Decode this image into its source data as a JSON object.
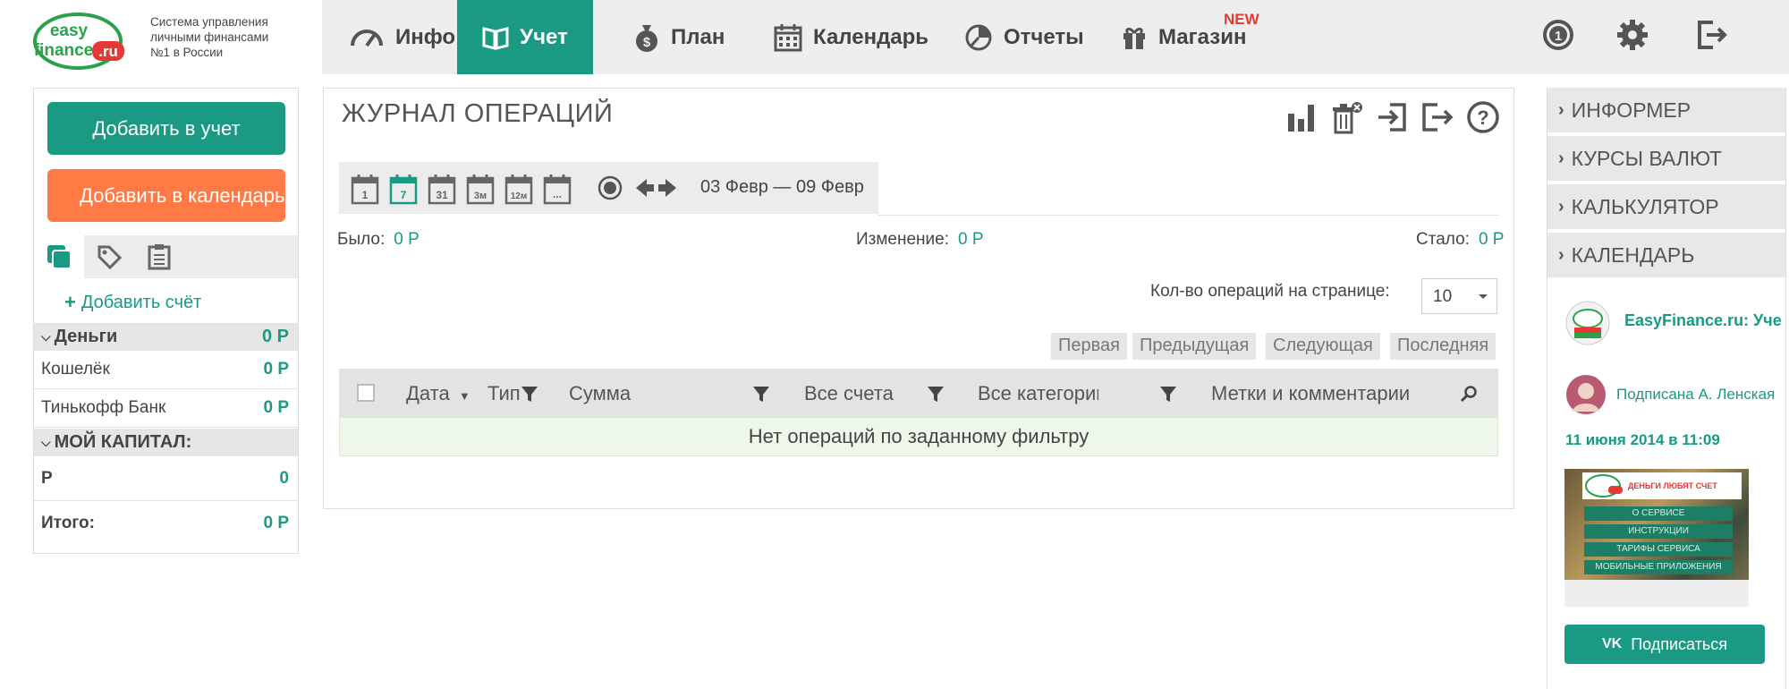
{
  "brand": {
    "logo_top": "easy",
    "logo_bottom": "finance",
    "logo_suffix": ".ru",
    "slogan": "Система управления личными финансами №1 в России"
  },
  "nav": {
    "items": [
      {
        "label": "Инфо",
        "icon": "speedometer-icon"
      },
      {
        "label": "Учет",
        "icon": "book-icon",
        "active": true
      },
      {
        "label": "План",
        "icon": "money-bag-icon"
      },
      {
        "label": "Календарь",
        "icon": "calendar-icon"
      },
      {
        "label": "Отчеты",
        "icon": "pie-chart-icon"
      },
      {
        "label": "Магазин",
        "icon": "gift-icon",
        "badge": "NEW"
      }
    ],
    "right_icons": [
      "number-one-icon",
      "gear-icon",
      "logout-icon"
    ]
  },
  "left": {
    "add_to_account": "Добавить в учет",
    "add_to_calendar": "Добавить в календарь",
    "tabs": [
      "accounts-icon",
      "tags-icon",
      "notes-icon"
    ],
    "add_account": "Добавить счёт",
    "groups": [
      {
        "title": "Деньги",
        "total": "0 Р",
        "accounts": [
          {
            "name": "Кошелёк",
            "value": "0 Р"
          },
          {
            "name": "Тинькофф Банк",
            "value": "0 Р"
          }
        ]
      },
      {
        "title": "МОЙ КАПИТАЛ:",
        "rows": [
          {
            "name": "Р",
            "value": "0"
          },
          {
            "name": "Итого:",
            "value": "0 Р"
          }
        ]
      }
    ]
  },
  "main": {
    "title": "ЖУРНАЛ ОПЕРАЦИЙ",
    "toolbar_icons": [
      "bar-chart-icon",
      "trash-icon",
      "import-icon",
      "export-icon",
      "help-icon"
    ],
    "period_icons": [
      "day",
      "7",
      "31",
      "3м",
      "12м",
      "..."
    ],
    "period_text": "03 Февр — 09 Февр",
    "summary": {
      "before_label": "Было:",
      "before_value": "0 Р",
      "change_label": "Изменение:",
      "change_value": "0 Р",
      "after_label": "Стало:",
      "after_value": "0 Р"
    },
    "per_page_label": "Кол-во операций на странице:",
    "per_page_value": "10",
    "pagination": [
      "Первая",
      "Предыдущая",
      "Следующая",
      "Последняя"
    ],
    "columns": {
      "date": "Дата",
      "type": "Тип",
      "amount": "Сумма",
      "accounts": "Все счета",
      "categories": "Все категории",
      "tags": "Метки и комментарии"
    },
    "empty_message": "Нет операций по заданному фильтру"
  },
  "right": {
    "widgets": [
      "ИНФОРМЕР",
      "КУРСЫ ВАЛЮТ",
      "КАЛЬКУЛЯТОР",
      "КАЛЕНДАРЬ"
    ],
    "vk": {
      "group_name": "EasyFinance.ru: Учет личных финансов",
      "subscribed_label": "Подписана",
      "subscriber_name": "А. Ленская",
      "post_date": "11 июня 2014 в 11:09",
      "banner_title": "ДЕНЬГИ ЛЮБЯТ СЧЕТ",
      "banner_items": [
        "О СЕРВИСЕ",
        "ИНСТРУКЦИИ",
        "ТАРИФЫ СЕРВИСА",
        "МОБИЛЬНЫЕ ПРИЛОЖЕНИЯ"
      ],
      "subscribe_button": "Подписаться"
    }
  },
  "colors": {
    "accent": "#1a9a82",
    "orange": "#ff7a45",
    "badge": "#e53935"
  }
}
